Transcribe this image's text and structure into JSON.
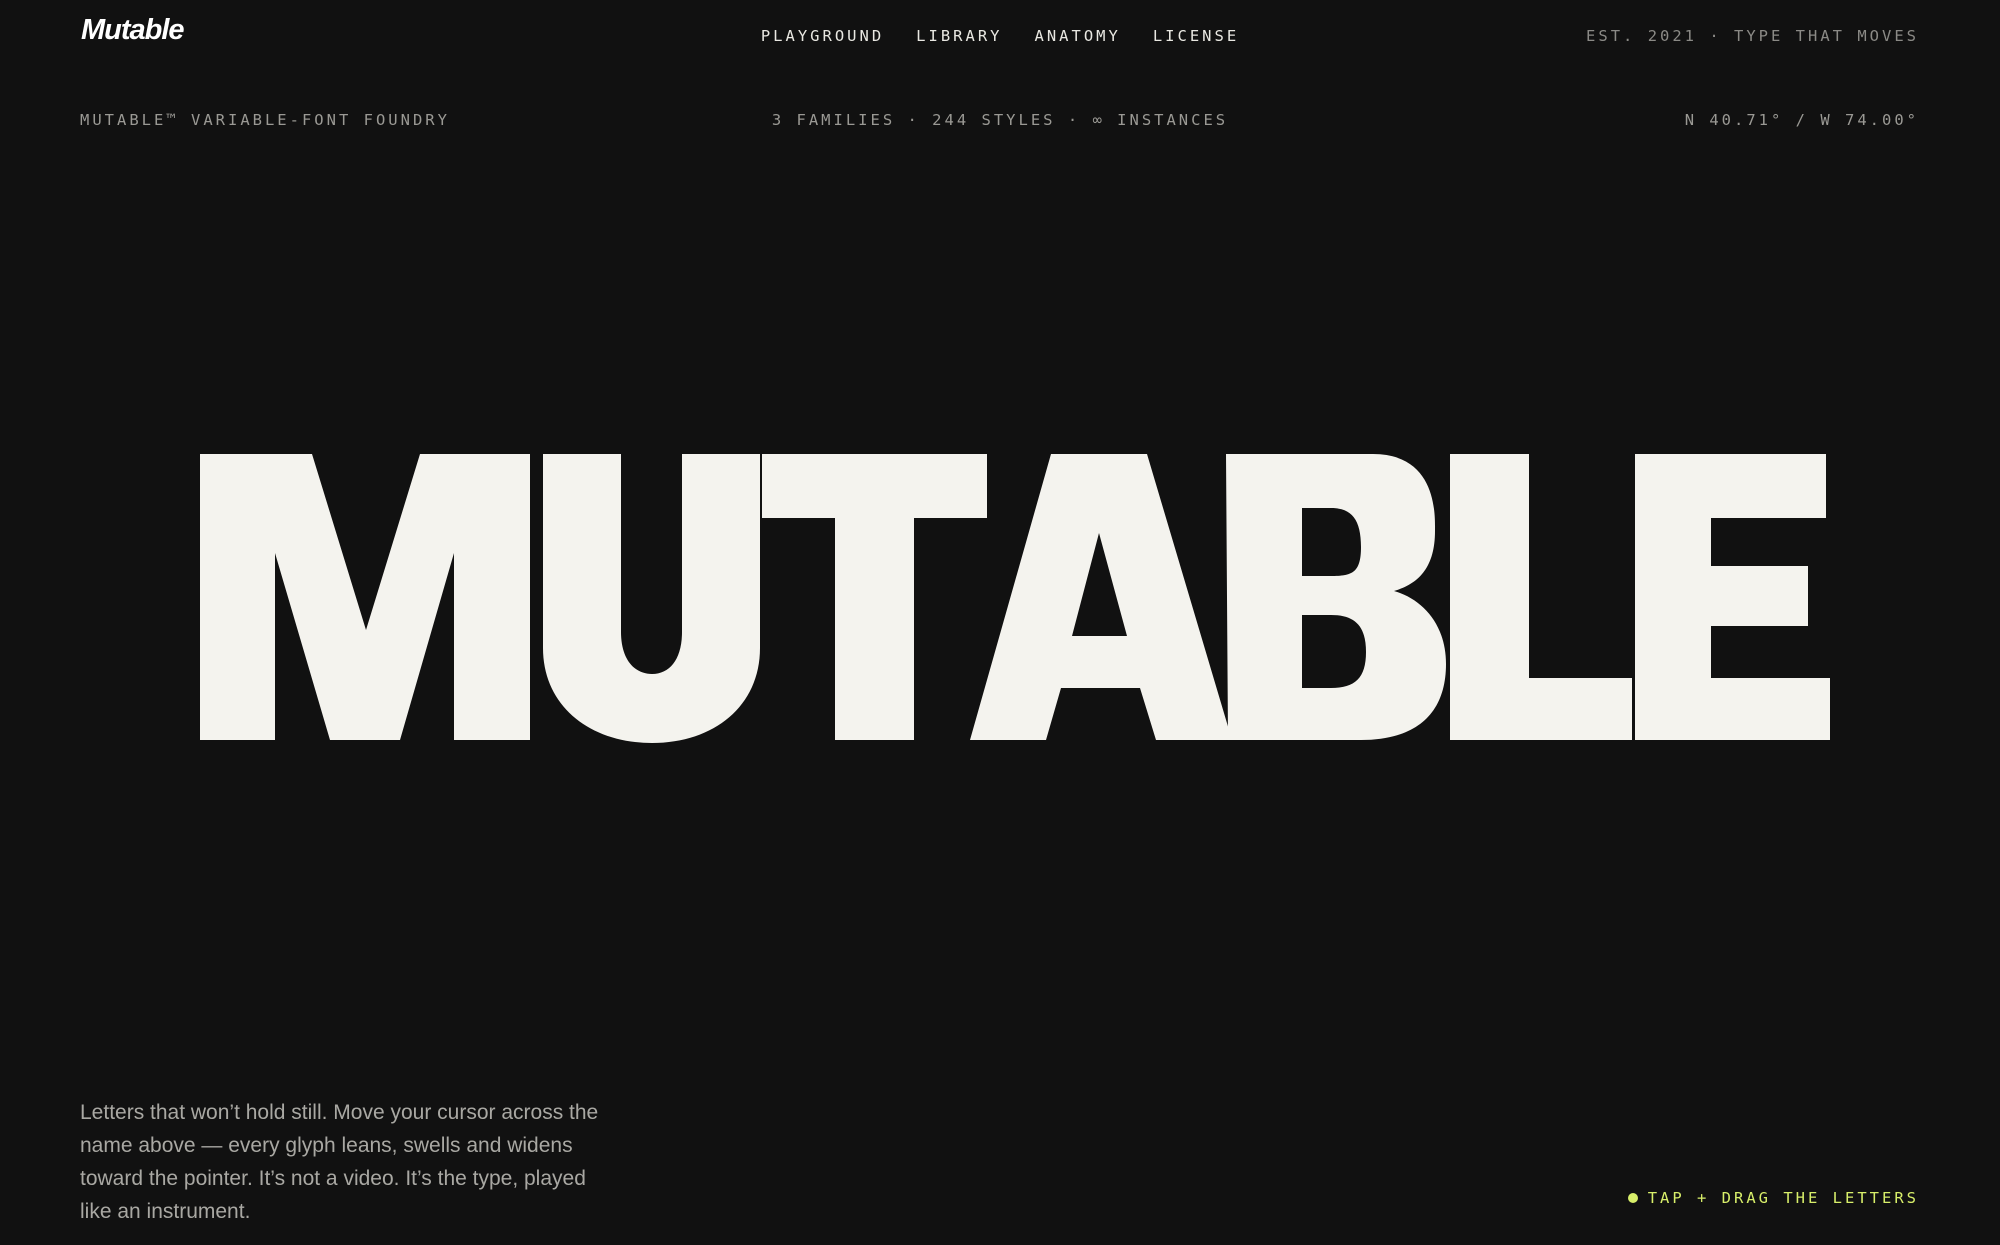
{
  "brand": {
    "logo": "Mutable"
  },
  "nav": {
    "items": [
      {
        "label": "PLAYGROUND"
      },
      {
        "label": "LIBRARY"
      },
      {
        "label": "ANATOMY"
      },
      {
        "label": "LICENSE"
      }
    ]
  },
  "header": {
    "tagline": "EST. 2021 · TYPE THAT MOVES"
  },
  "meta": {
    "left": "MUTABLE™ VARIABLE-FONT FOUNDRY",
    "center": "3 FAMILIES · 244 STYLES · ∞ INSTANCES",
    "right": "N 40.71° / W 74.00°"
  },
  "hero": {
    "word": "MUTABLE",
    "letters": [
      "M",
      "U",
      "T",
      "A",
      "B",
      "L",
      "E"
    ]
  },
  "description": "Letters that won’t hold still. Move your cursor across the name above — every glyph leans, swells and widens toward the pointer. It’s not a video. It’s the type, played like an instrument.",
  "hint": {
    "label": "TAP + DRAG THE LETTERS"
  },
  "colors": {
    "background": "#111111",
    "letters": "#f4f3ee",
    "accent": "#d8ef6a",
    "muted_text": "#9a9994"
  }
}
